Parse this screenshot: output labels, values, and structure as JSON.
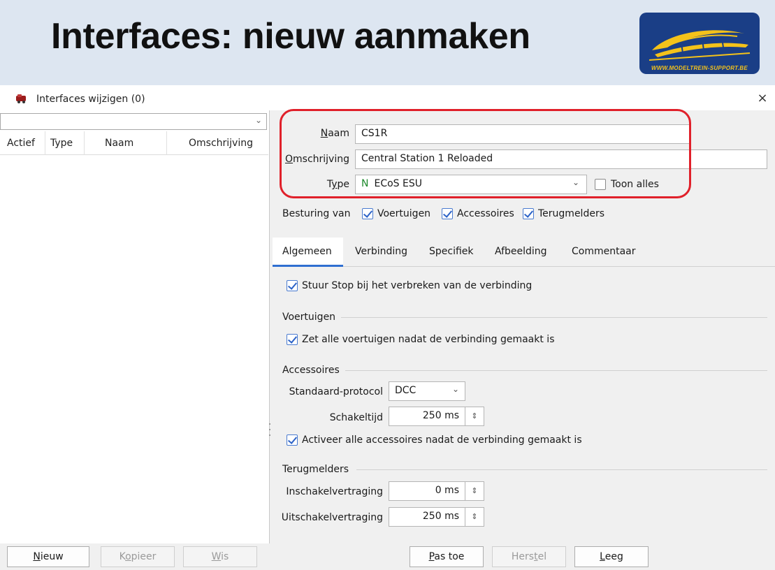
{
  "slide": {
    "title": "Interfaces: nieuw aanmaken",
    "logo_text": "WWW.MODELTREIN-SUPPORT.BE",
    "header_bg": "#dde6f1",
    "logo_bg": "#1a3e86",
    "logo_accent": "#f4c21a"
  },
  "window": {
    "title": "Interfaces wijzigen (0)",
    "close_glyph": "×"
  },
  "left_panel": {
    "filter_value": "",
    "columns": [
      "Actief",
      "Type",
      "Naam",
      "Omschrijving"
    ],
    "rows": [],
    "buttons": {
      "new_pre": "",
      "new_u": "N",
      "new_post": "ieuw",
      "copy_pre": "K",
      "copy_u": "o",
      "copy_post": "pieer",
      "delete_pre": "",
      "delete_u": "W",
      "delete_post": "is"
    }
  },
  "form": {
    "name_label_u": "N",
    "name_label_rest": "aam",
    "name_value": "CS1R",
    "desc_label_u": "O",
    "desc_label_rest": "mschrijving",
    "desc_value": "Central Station 1 Reloaded",
    "type_label_pre": "T",
    "type_label_u": "y",
    "type_label_post": "pe",
    "type_prefix": "N",
    "type_value": "ECoS ESU",
    "show_all_label": "Toon alles",
    "show_all_checked": false,
    "control_label": "Besturing van",
    "control_vehicles": "Voertuigen",
    "control_accessories": "Accessoires",
    "control_feedback": "Terugmelders"
  },
  "tabs": [
    "Algemeen",
    "Verbinding",
    "Specifiek",
    "Afbeelding",
    "Commentaar"
  ],
  "general": {
    "stop_on_disconnect": "Stuur Stop bij het verbreken van de verbinding",
    "vehicles_section": "Voertuigen",
    "vehicles_set_all": "Zet alle voertuigen nadat de verbinding gemaakt is",
    "accessories_section": "Accessoires",
    "std_protocol_label": "Standaard-protocol",
    "std_protocol_value": "DCC",
    "switch_time_label": "Schakeltijd",
    "switch_time_value": "250 ms",
    "activate_all_accessories": "Activeer alle accessoires nadat de verbinding gemaakt is",
    "feedback_section": "Terugmelders",
    "on_delay_label": "Inschakelvertraging",
    "on_delay_value": "0 ms",
    "off_delay_label": "Uitschakelvertraging",
    "off_delay_value": "250 ms"
  },
  "bottom_buttons": {
    "apply_u": "P",
    "apply_rest": "as toe",
    "restore_pre": "Hers",
    "restore_u": "t",
    "restore_post": "el",
    "clear_pre": "",
    "clear_u": "L",
    "clear_post": "eeg"
  }
}
